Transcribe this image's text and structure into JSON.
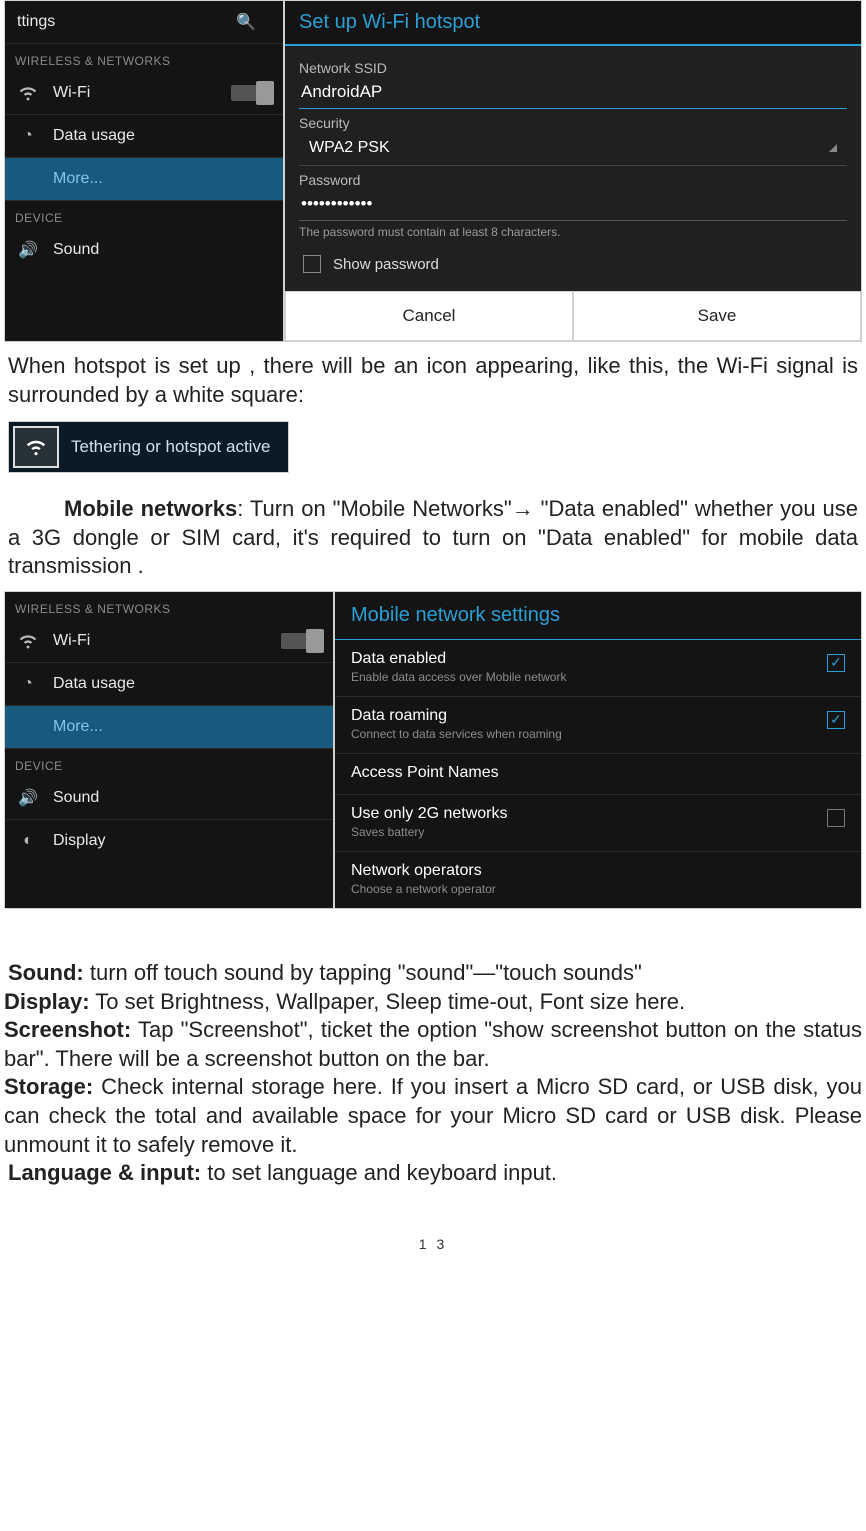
{
  "settings1": {
    "titlebar_fragment": "ttings",
    "section_header": "WIRELESS & NETWORKS",
    "wifi_label": "Wi-Fi",
    "wifi_toggle_state": "OFF",
    "data_usage_label": "Data usage",
    "more_label": "More...",
    "device_header": "DEVICE",
    "sound_label": "Sound"
  },
  "hotspot_dialog": {
    "title": "Set up Wi-Fi hotspot",
    "ssid_label": "Network SSID",
    "ssid_value": "AndroidAP",
    "security_label": "Security",
    "security_value": "WPA2 PSK",
    "password_label": "Password",
    "password_value": "••••••••••••",
    "help_text": "The password must contain at least 8 characters.",
    "show_password_label": "Show password",
    "cancel_label": "Cancel",
    "save_label": "Save"
  },
  "body_text": {
    "p1": "When hotspot is set up , there will be an icon appearing, like this, the Wi-Fi signal is surrounded by a white square:",
    "notif_text": "Tethering or hotspot active",
    "p2_b": "Mobile networks",
    "p2_rest": ": Turn on \"Mobile Networks\"→ \"Data enabled\" whether you use a 3G dongle or SIM card, it's required to turn on \"Data enabled\" for mobile data transmission .",
    "p3_sound_b": "Sound:",
    "p3_sound": " turn off touch sound by tapping \"sound\"—\"touch sounds\"",
    "p3_display_b": "Display:",
    "p3_display": " To set Brightness, Wallpaper, Sleep time-out, Font size here.",
    "p3_ss_b": "Screenshot:",
    "p3_ss": " Tap \"Screenshot\", ticket the option \"show screenshot button on the status bar\". There will be a screenshot button on the bar.",
    "p3_storage_b": "Storage:",
    "p3_storage": " Check internal storage here. If you insert a Micro SD card, or USB disk, you can check the total and available space for your Micro SD card or USB disk.   Please unmount it to safely remove it.",
    "p3_lang_b": "Language & input:",
    "p3_lang": " to set language and keyboard input."
  },
  "settings2": {
    "section_header": "WIRELESS & NETWORKS",
    "wifi_label": "Wi-Fi",
    "data_usage_label": "Data usage",
    "more_label": "More...",
    "device_header": "DEVICE",
    "sound_label": "Sound",
    "display_label": "Display"
  },
  "mns": {
    "title": "Mobile network settings",
    "data_enabled_label": "Data enabled",
    "data_enabled_sub": "Enable data access over Mobile network",
    "data_roaming_label": "Data roaming",
    "data_roaming_sub": "Connect to data services when roaming",
    "apn_label": "Access Point Names",
    "g2_label": "Use only 2G networks",
    "g2_sub": "Saves battery",
    "ops_label": "Network operators",
    "ops_sub": "Choose a network operator"
  },
  "pagenum": "1 3"
}
